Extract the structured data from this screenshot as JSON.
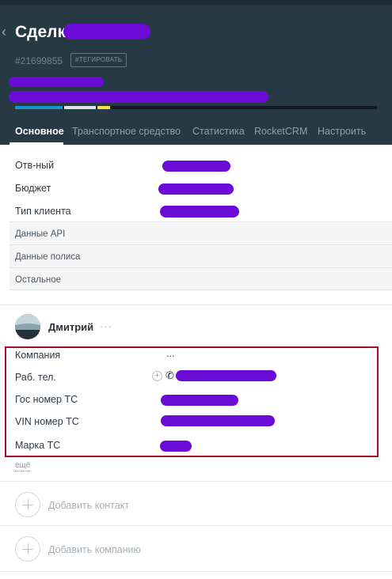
{
  "header": {
    "back_glyph": "‹",
    "title": "Сделка",
    "deal_id": "#21699855",
    "tag_button": "#ТЕГИРОВАТЬ",
    "colors": {
      "background": "#273a44",
      "redaction": "#6a0bd6"
    }
  },
  "pipeline": {
    "filled_fraction": 0.26,
    "segment_colors": [
      "#1a94c9",
      "#dfe6e9",
      "#f4e24a"
    ]
  },
  "tabs": [
    {
      "label": "Основное",
      "active": true
    },
    {
      "label": "Транспортное средство",
      "active": false
    },
    {
      "label": "Статистика",
      "active": false
    },
    {
      "label": "RocketCRM",
      "active": false
    },
    {
      "label": "Настроить",
      "active": false
    }
  ],
  "fields": [
    {
      "label": "Отв-ный"
    },
    {
      "label": "Бюджет"
    },
    {
      "label": "Тип клиента"
    }
  ],
  "sections": [
    {
      "label": "Данные API"
    },
    {
      "label": "Данные полиса"
    },
    {
      "label": "Остальное"
    }
  ],
  "contact": {
    "name": "Дмитрий",
    "more": "···",
    "fields": [
      {
        "label": "Компания",
        "value": "..."
      },
      {
        "label": "Раб. тел.",
        "value": ""
      },
      {
        "label": "Гос номер ТС",
        "value": ""
      },
      {
        "label": "VIN номер ТС",
        "value": ""
      },
      {
        "label": "Марка ТС",
        "value": ""
      }
    ],
    "more_link": "ещё",
    "highlight_color": "#a50d2a"
  },
  "actions": {
    "add_contact": "Добавить контакт",
    "add_company": "Добавить компанию"
  }
}
